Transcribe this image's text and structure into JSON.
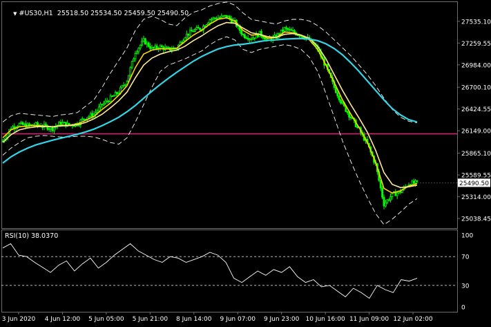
{
  "header": {
    "symbol": "#US30,H1",
    "ohlc": "25518.50 25534.50 25459.50 25490.50"
  },
  "price_axis": {
    "labels": [
      "27535.10",
      "27259.55",
      "26984.00",
      "26700.10",
      "26424.55",
      "26149.00",
      "25865.10",
      "25589.55",
      "25314.00",
      "25038.45"
    ],
    "current_price": "25490.50"
  },
  "rsi": {
    "title": "RSI(10) 38.0370",
    "levels": [
      "100",
      "70",
      "30",
      "0"
    ]
  },
  "time_axis": {
    "labels": [
      "3 Jun 2020",
      "4 Jun 12:00",
      "5 Jun 05:00",
      "5 Jun 21:00",
      "8 Jun 14:00",
      "9 Jun 07:00",
      "9 Jun 23:00",
      "10 Jun 16:00",
      "11 Jun 09:00",
      "12 Jun 02:00"
    ]
  },
  "colors": {
    "background": "#000000",
    "grid": "#6e6e6e",
    "candle_bull": "#00ff00",
    "ma_fast": "#ffd400",
    "ma_mid": "#ffe89a",
    "ma_slow": "#33d6e6",
    "horizontal_line": "#e8177a",
    "bands": "#ffffff",
    "rsi_line": "#ffffff",
    "price_tag_bg": "#ffffff",
    "price_tag_fg": "#000000"
  },
  "chart_data": {
    "type": "line",
    "price_chart": {
      "y_ticks": [
        27535.1,
        27259.55,
        26984.0,
        26700.1,
        26424.55,
        26149.0,
        25865.1,
        25589.55,
        25314.0,
        25038.45
      ],
      "ylim": [
        24960,
        27700
      ],
      "horizontal_level": 26110,
      "last_price": 25490.5,
      "x_categories": [
        "3 Jun 2020",
        "4 Jun 12:00",
        "5 Jun 05:00",
        "5 Jun 21:00",
        "8 Jun 14:00",
        "9 Jun 07:00",
        "9 Jun 23:00",
        "10 Jun 16:00",
        "11 Jun 09:00",
        "12 Jun 02:00"
      ],
      "close": [
        26020,
        26190,
        26230,
        26215,
        26225,
        26205,
        26180,
        26250,
        26220,
        26240,
        26320,
        26360,
        26480,
        26560,
        26640,
        26790,
        27150,
        27290,
        27190,
        27210,
        27180,
        27200,
        27350,
        27420,
        27450,
        27560,
        27580,
        27600,
        27520,
        27360,
        27320,
        27380,
        27300,
        27340,
        27440,
        27400,
        27360,
        27300,
        27180,
        26960,
        26700,
        26480,
        26320,
        26160,
        25980,
        25720,
        25220,
        25340,
        25380,
        25480,
        25490
      ],
      "series": [
        {
          "name": "",
          "role": "ma_fast",
          "values": [
            26060,
            26160,
            26200,
            26210,
            26215,
            26210,
            26200,
            26215,
            26220,
            26235,
            26280,
            26330,
            26420,
            26500,
            26600,
            26720,
            26950,
            27120,
            27170,
            27190,
            27185,
            27195,
            27280,
            27360,
            27420,
            27500,
            27560,
            27580,
            27540,
            27420,
            27360,
            27370,
            27320,
            27330,
            27400,
            27390,
            27360,
            27300,
            27180,
            26980,
            26760,
            26540,
            26360,
            26190,
            26000,
            25750,
            25420,
            25360,
            25390,
            25450,
            25480
          ]
        },
        {
          "name": "",
          "role": "ma_mid",
          "values": [
            26000,
            26100,
            26160,
            26185,
            26200,
            26205,
            26200,
            26210,
            26215,
            26225,
            26255,
            26300,
            26360,
            26440,
            26530,
            26640,
            26820,
            26980,
            27070,
            27120,
            27150,
            27170,
            27220,
            27290,
            27350,
            27420,
            27480,
            27520,
            27510,
            27450,
            27390,
            27370,
            27340,
            27330,
            27370,
            27380,
            27360,
            27320,
            27220,
            27060,
            26860,
            26660,
            26480,
            26310,
            26130,
            25900,
            25620,
            25470,
            25430,
            25440,
            25460
          ]
        },
        {
          "name": "",
          "role": "ma_slow",
          "values": [
            25740,
            25820,
            25880,
            25930,
            25970,
            26000,
            26030,
            26055,
            26080,
            26105,
            26135,
            26170,
            26215,
            26265,
            26320,
            26390,
            26470,
            26560,
            26650,
            26735,
            26815,
            26890,
            26960,
            27030,
            27090,
            27140,
            27185,
            27215,
            27235,
            27245,
            27260,
            27280,
            27295,
            27300,
            27310,
            27315,
            27318,
            27310,
            27290,
            27250,
            27190,
            27110,
            27010,
            26900,
            26780,
            26660,
            26540,
            26430,
            26350,
            26290,
            26260
          ]
        },
        {
          "name": "",
          "role": "band_upper",
          "values": [
            26260,
            26340,
            26370,
            26360,
            26350,
            26340,
            26330,
            26350,
            26360,
            26380,
            26460,
            26540,
            26700,
            26880,
            27040,
            27200,
            27420,
            27560,
            27600,
            27560,
            27500,
            27480,
            27580,
            27650,
            27680,
            27730,
            27760,
            27780,
            27740,
            27640,
            27560,
            27540,
            27520,
            27500,
            27540,
            27560,
            27560,
            27540,
            27480,
            27400,
            27300,
            27200,
            27100,
            26980,
            26860,
            26720,
            26560,
            26420,
            26320,
            26270,
            26250
          ]
        },
        {
          "name": "",
          "role": "band_lower",
          "values": [
            25840,
            25930,
            26000,
            26060,
            26080,
            26090,
            26080,
            26070,
            26070,
            26080,
            26080,
            26070,
            26040,
            26000,
            25980,
            26060,
            26260,
            26480,
            26700,
            26900,
            26980,
            27020,
            27060,
            27110,
            27160,
            27240,
            27300,
            27340,
            27300,
            27180,
            27140,
            27180,
            27200,
            27220,
            27240,
            27220,
            27180,
            27080,
            26900,
            26620,
            26320,
            26020,
            25760,
            25520,
            25300,
            25100,
            24960,
            25030,
            25120,
            25220,
            25290
          ]
        }
      ]
    },
    "rsi_chart": {
      "title": "RSI(10) 38.0370",
      "ylim": [
        0,
        100
      ],
      "levels": [
        70,
        30
      ],
      "values": [
        82,
        88,
        72,
        70,
        62,
        55,
        48,
        58,
        64,
        50,
        60,
        68,
        54,
        62,
        72,
        80,
        88,
        78,
        72,
        66,
        62,
        70,
        68,
        62,
        66,
        70,
        76,
        72,
        62,
        40,
        34,
        42,
        50,
        44,
        52,
        48,
        56,
        42,
        34,
        38,
        28,
        30,
        22,
        14,
        26,
        20,
        12,
        30,
        24,
        20,
        38,
        36,
        40
      ]
    }
  }
}
